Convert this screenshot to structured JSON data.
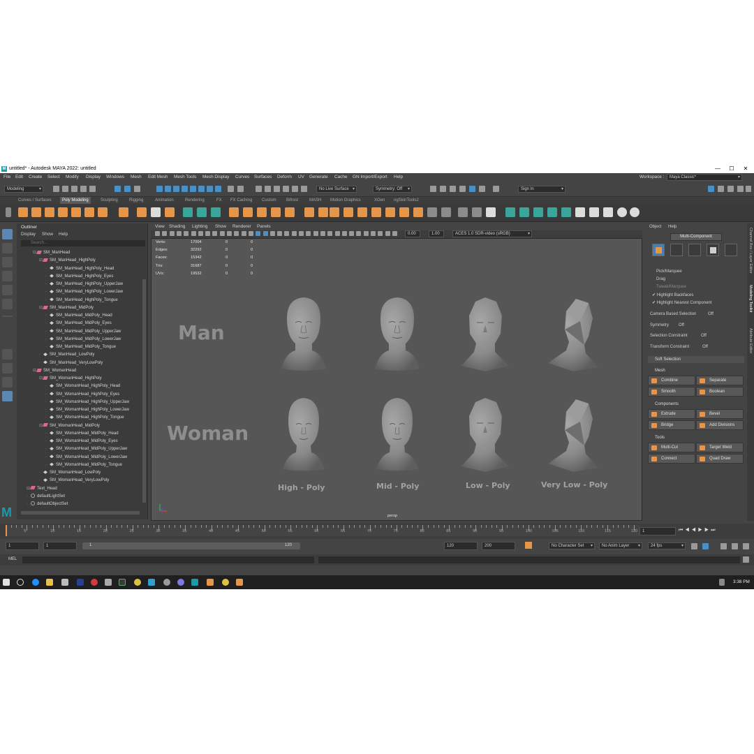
{
  "window": {
    "title": "untitled* - Autodesk MAYA 2022: untitled",
    "minimize": "—",
    "maximize": "☐",
    "close": "✕"
  },
  "menubar": {
    "items": [
      "File",
      "Edit",
      "Create",
      "Select",
      "Modify",
      "Display",
      "Windows",
      "Mesh",
      "Edit Mesh",
      "Mesh Tools",
      "Mesh Display",
      "Curves",
      "Surfaces",
      "Deform",
      "UV",
      "Generate",
      "Cache",
      "GN Import/Export",
      "Help"
    ],
    "workspace_label": "Workspace :",
    "workspace_value": "Maya Classic*"
  },
  "statusline": {
    "menuset": "Modeling",
    "live_surface": "No Live Surface",
    "symmetry": "Symmetry: Off",
    "sign_in": "Sign In"
  },
  "shelf": {
    "tabs": [
      "Curves / Surfaces",
      "Poly Modeling",
      "Sculpting",
      "Rigging",
      "Animation",
      "Rendering",
      "FX",
      "FX Caching",
      "Custom",
      "Bifrost",
      "MASH",
      "Motion Graphics",
      "XGen",
      "ngSkinTools2"
    ],
    "active_tab": "Poly Modeling"
  },
  "outliner": {
    "title": "Outliner",
    "menus": [
      "Display",
      "Show",
      "Help"
    ],
    "search_placeholder": "Search...",
    "rows": [
      {
        "label": "SM_ManHead",
        "depth": 1,
        "kind": "grp"
      },
      {
        "label": "SM_ManHead_HighPoly",
        "depth": 2,
        "kind": "grp"
      },
      {
        "label": "SM_ManHead_HighPoly_Head",
        "depth": 3,
        "kind": "mesh"
      },
      {
        "label": "SM_ManHead_HighPoly_Eyes",
        "depth": 3,
        "kind": "mesh"
      },
      {
        "label": "SM_ManHead_HighPoly_UpperJaw",
        "depth": 3,
        "kind": "mesh"
      },
      {
        "label": "SM_ManHead_HighPoly_LowerJaw",
        "depth": 3,
        "kind": "mesh"
      },
      {
        "label": "SM_ManHead_HighPoly_Tongue",
        "depth": 3,
        "kind": "mesh"
      },
      {
        "label": "SM_ManHead_MidPoly",
        "depth": 2,
        "kind": "grp"
      },
      {
        "label": "SM_ManHead_MidPoly_Head",
        "depth": 3,
        "kind": "mesh"
      },
      {
        "label": "SM_ManHead_MidPoly_Eyes",
        "depth": 3,
        "kind": "mesh"
      },
      {
        "label": "SM_ManHead_MidPoly_UpperJaw",
        "depth": 3,
        "kind": "mesh"
      },
      {
        "label": "SM_ManHead_MidPoly_LowerJaw",
        "depth": 3,
        "kind": "mesh"
      },
      {
        "label": "SM_ManHead_MidPoly_Tongue",
        "depth": 3,
        "kind": "mesh"
      },
      {
        "label": "SM_ManHead_LowPoly",
        "depth": 2,
        "kind": "mesh"
      },
      {
        "label": "SM_ManHead_VeryLowPoly",
        "depth": 2,
        "kind": "mesh"
      },
      {
        "label": "SM_WomanHead",
        "depth": 1,
        "kind": "grp"
      },
      {
        "label": "SM_WomanHead_HighPoly",
        "depth": 2,
        "kind": "grp"
      },
      {
        "label": "SM_WomanHead_HighPoly_Head",
        "depth": 3,
        "kind": "mesh"
      },
      {
        "label": "SM_WomanHead_HighPoly_Eyes",
        "depth": 3,
        "kind": "mesh"
      },
      {
        "label": "SM_WomanHead_HighPoly_UpperJaw",
        "depth": 3,
        "kind": "mesh"
      },
      {
        "label": "SM_WomanHead_HighPoly_LowerJaw",
        "depth": 3,
        "kind": "mesh"
      },
      {
        "label": "SM_WomanHead_HighPoly_Tongue",
        "depth": 3,
        "kind": "mesh"
      },
      {
        "label": "SM_WomanHead_MidPoly",
        "depth": 2,
        "kind": "grp"
      },
      {
        "label": "SM_WomanHead_MidPoly_Head",
        "depth": 3,
        "kind": "mesh"
      },
      {
        "label": "SM_WomanHead_MidPoly_Eyes",
        "depth": 3,
        "kind": "mesh"
      },
      {
        "label": "SM_WomanHead_MidPoly_UpperJaw",
        "depth": 3,
        "kind": "mesh"
      },
      {
        "label": "SM_WomanHead_MidPoly_LowerJaw",
        "depth": 3,
        "kind": "mesh"
      },
      {
        "label": "SM_WomanHead_MidPoly_Tongue",
        "depth": 3,
        "kind": "mesh"
      },
      {
        "label": "SM_WomanHead_LowPoly",
        "depth": 2,
        "kind": "mesh"
      },
      {
        "label": "SM_WomanHead_VeryLowPoly",
        "depth": 2,
        "kind": "mesh"
      },
      {
        "label": "Text_Head",
        "depth": 0,
        "kind": "grp"
      },
      {
        "label": "defaultLightSet",
        "depth": 0,
        "kind": "set"
      },
      {
        "label": "defaultObjectSet",
        "depth": 0,
        "kind": "set"
      }
    ]
  },
  "viewport": {
    "menus": [
      "View",
      "Shading",
      "Lighting",
      "Show",
      "Renderer",
      "Panels"
    ],
    "exposure": "0.00",
    "gamma": "1.00",
    "color_space": "ACES 1.0 SDR-video (sRGB)",
    "camera": "persp",
    "hud": [
      {
        "label": "Verts:",
        "values": [
          "17004",
          "0",
          "0"
        ]
      },
      {
        "label": "Edges:",
        "values": [
          "32292",
          "0",
          "0"
        ]
      },
      {
        "label": "Faces:",
        "values": [
          "15342",
          "0",
          "0"
        ]
      },
      {
        "label": "Tris:",
        "values": [
          "31687",
          "0",
          "0"
        ]
      },
      {
        "label": "UVs:",
        "values": [
          "19532",
          "0",
          "0"
        ]
      }
    ],
    "row_labels": [
      "Man",
      "Woman"
    ],
    "column_labels": [
      "High - Poly",
      "Mid - Poly",
      "Low - Poly",
      "Very Low - Poly"
    ]
  },
  "toolkit": {
    "menus": [
      "Object",
      "Help"
    ],
    "mode_button": "Multi-Component",
    "pick_marquee": "Pick/Marquee",
    "drag": "Drag",
    "tweak_marquee": "Tweak/Marquee",
    "highlight_backfaces": "Highlight Backfaces",
    "highlight_nearest": "Highlight Nearest Component",
    "camera_based_selection": "Camera Based Selection",
    "camera_based_value": "Off",
    "symmetry": "Symmetry",
    "symmetry_value": "Off",
    "selection_constraint": "Selection Constraint",
    "selection_constraint_value": "Off",
    "transform_constraint": "Transform Constraint",
    "transform_constraint_value": "Off",
    "soft_selection": "Soft Selection",
    "mesh_section": "Mesh",
    "combine": "Combine",
    "separate": "Separate",
    "smooth": "Smooth",
    "boolean": "Boolean",
    "components_section": "Components",
    "extrude": "Extrude",
    "bevel": "Bevel",
    "bridge": "Bridge",
    "add_divisions": "Add Divisions",
    "tools_section": "Tools",
    "multi_cut": "Multi-Cut",
    "target_weld": "Target Weld",
    "connect": "Connect",
    "quad_draw": "Quad Draw",
    "side_tabs": [
      "Channel Box / Layer Editor",
      "Modeling Toolkit",
      "Attribute Editor"
    ]
  },
  "timeline": {
    "ticks": [
      "5",
      "10",
      "15",
      "20",
      "25",
      "30",
      "35",
      "40",
      "45",
      "50",
      "55",
      "60",
      "65",
      "70",
      "75",
      "80",
      "85",
      "90",
      "95",
      "100",
      "105",
      "110",
      "115",
      "120"
    ],
    "current_frame": "1"
  },
  "range": {
    "start": "1",
    "start2": "1",
    "slider_start": "1",
    "slider_end": "120",
    "end": "120",
    "end2": "200",
    "character_set": "No Character Set",
    "anim_layer": "No Anim Layer",
    "fps": "24 fps"
  },
  "mel": {
    "label": "MEL"
  },
  "taskbar": {
    "time": "3:38 PM"
  }
}
